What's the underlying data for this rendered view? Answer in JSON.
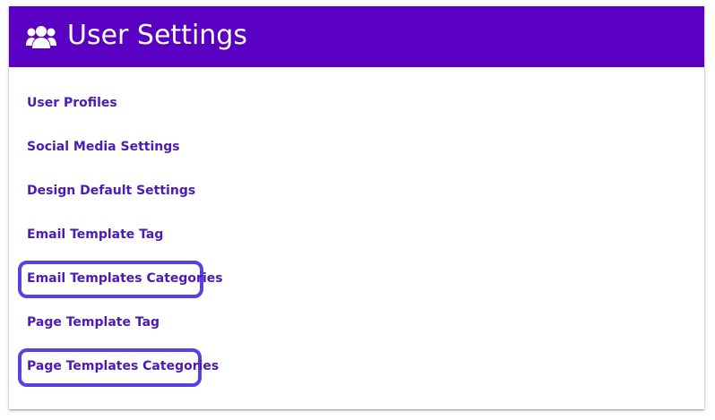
{
  "header": {
    "title": "User Settings",
    "icon": "users-icon",
    "background": "#5a00c2"
  },
  "links": [
    {
      "label": "User Profiles"
    },
    {
      "label": "Social Media Settings"
    },
    {
      "label": "Design Default Settings"
    },
    {
      "label": "Email Template Tag"
    },
    {
      "label": "Email Templates Categories",
      "highlighted": true
    },
    {
      "label": "Page Template Tag"
    },
    {
      "label": "Page Templates Categories",
      "highlighted": true
    }
  ],
  "colors": {
    "link": "#4a1bb8",
    "highlight_border": "#5b3fe2"
  }
}
